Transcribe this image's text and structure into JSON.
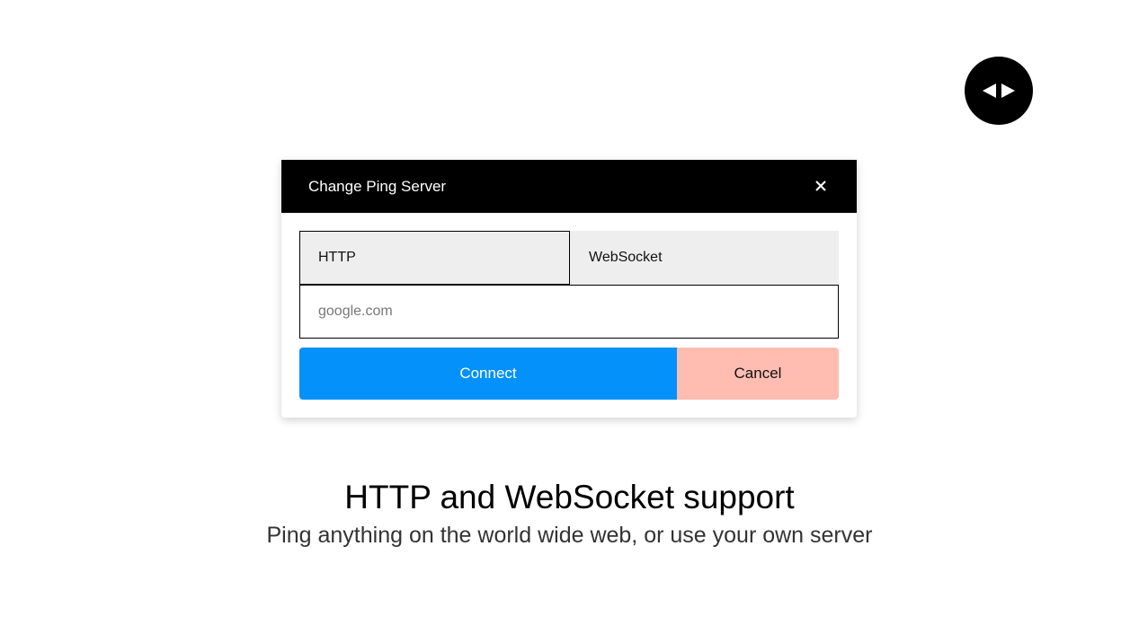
{
  "nav_control": {
    "icons": [
      "triangle-left-icon",
      "triangle-right-icon"
    ]
  },
  "dialog": {
    "title": "Change Ping Server",
    "close_icon": "close-icon",
    "tabs": [
      {
        "label": "HTTP",
        "selected": true
      },
      {
        "label": "WebSocket",
        "selected": false
      }
    ],
    "server_input": {
      "value": "",
      "placeholder": "google.com"
    },
    "connect_label": "Connect",
    "cancel_label": "Cancel"
  },
  "caption": {
    "headline": "HTTP and WebSocket support",
    "subline": "Ping anything on the world wide web, or use your own server"
  },
  "colors": {
    "header_bg": "#000000",
    "connect_bg": "#0591fa",
    "cancel_bg": "#ffbdb2",
    "tab_bg": "#eeeeee"
  }
}
